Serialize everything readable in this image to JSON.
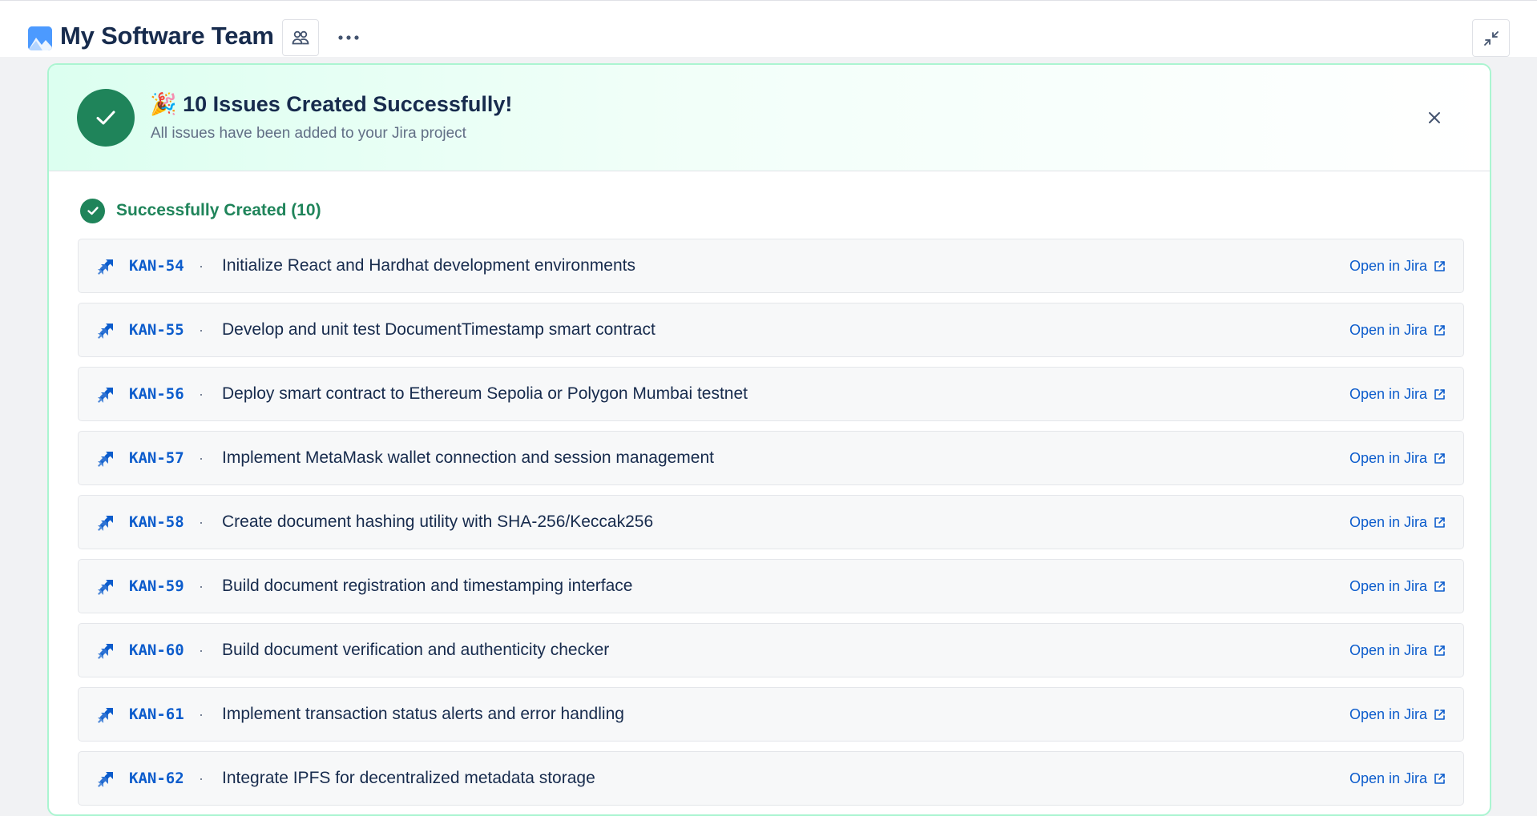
{
  "header": {
    "project_title": "My Software Team"
  },
  "banner": {
    "emoji": "🎉",
    "title": "10 Issues Created Successfully!",
    "subtitle": "All issues have been added to your Jira project"
  },
  "section": {
    "title": "Successfully Created (10)"
  },
  "issues": [
    {
      "key": "KAN-54",
      "summary": "Initialize React and Hardhat development environments",
      "link": "Open in Jira"
    },
    {
      "key": "KAN-55",
      "summary": "Develop and unit test DocumentTimestamp smart contract",
      "link": "Open in Jira"
    },
    {
      "key": "KAN-56",
      "summary": "Deploy smart contract to Ethereum Sepolia or Polygon Mumbai testnet",
      "link": "Open in Jira"
    },
    {
      "key": "KAN-57",
      "summary": "Implement MetaMask wallet connection and session management",
      "link": "Open in Jira"
    },
    {
      "key": "KAN-58",
      "summary": "Create document hashing utility with SHA-256/Keccak256",
      "link": "Open in Jira"
    },
    {
      "key": "KAN-59",
      "summary": "Build document registration and timestamping interface",
      "link": "Open in Jira"
    },
    {
      "key": "KAN-60",
      "summary": "Build document verification and authenticity checker",
      "link": "Open in Jira"
    },
    {
      "key": "KAN-61",
      "summary": "Implement transaction status alerts and error handling",
      "link": "Open in Jira"
    },
    {
      "key": "KAN-62",
      "summary": "Integrate IPFS for decentralized metadata storage",
      "link": "Open in Jira"
    }
  ],
  "separator": "·",
  "colors": {
    "success": "#1f845a",
    "link": "#0c5ccc",
    "panel_border": "#abf5d1"
  }
}
